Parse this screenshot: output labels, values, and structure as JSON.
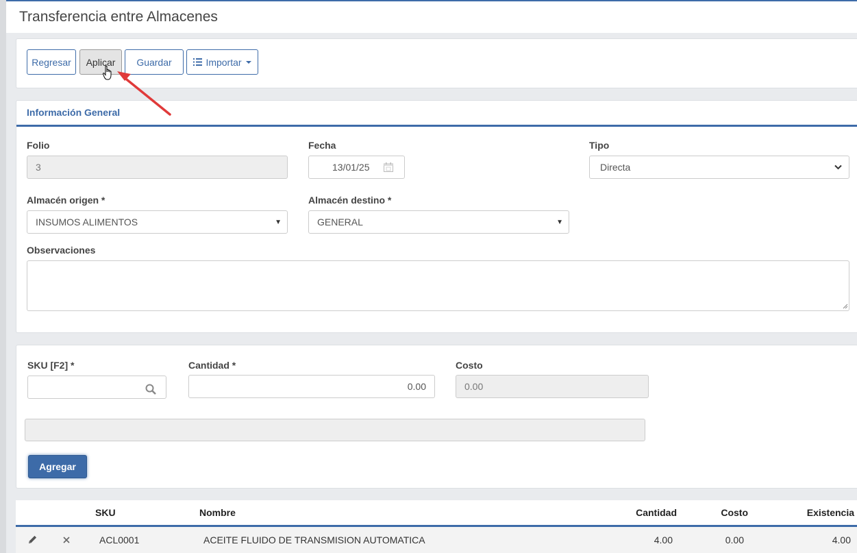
{
  "page": {
    "title": "Transferencia entre Almacenes"
  },
  "toolbar": {
    "back_label": "Regresar",
    "apply_label": "Aplicar",
    "save_label": "Guardar",
    "import_label": "Importar"
  },
  "general": {
    "section_title": "Información General",
    "folio": {
      "label": "Folio",
      "value": "3"
    },
    "fecha": {
      "label": "Fecha",
      "value": "13/01/25"
    },
    "tipo": {
      "label": "Tipo",
      "value": "Directa"
    },
    "origen": {
      "label": "Almacén origen *",
      "value": "INSUMOS ALIMENTOS"
    },
    "destino": {
      "label": "Almacén destino *",
      "value": "GENERAL"
    },
    "observaciones": {
      "label": "Observaciones",
      "value": ""
    }
  },
  "entry": {
    "sku": {
      "label": "SKU [F2] *",
      "value": ""
    },
    "cantidad": {
      "label": "Cantidad *",
      "value": "0.00"
    },
    "costo": {
      "label": "Costo",
      "value": "0.00"
    },
    "add_label": "Agregar"
  },
  "table": {
    "headers": {
      "sku": "SKU",
      "nombre": "Nombre",
      "cantidad": "Cantidad",
      "costo": "Costo",
      "existencia": "Existencia"
    },
    "rows": [
      {
        "sku": "ACL0001",
        "nombre": "ACEITE FLUIDO DE TRANSMISION AUTOMATICA",
        "cantidad": "4.00",
        "costo": "0.00",
        "existencia": "4.00"
      }
    ]
  },
  "colors": {
    "accent": "#3d6ba8",
    "annotation_arrow": "#e03a3a"
  }
}
